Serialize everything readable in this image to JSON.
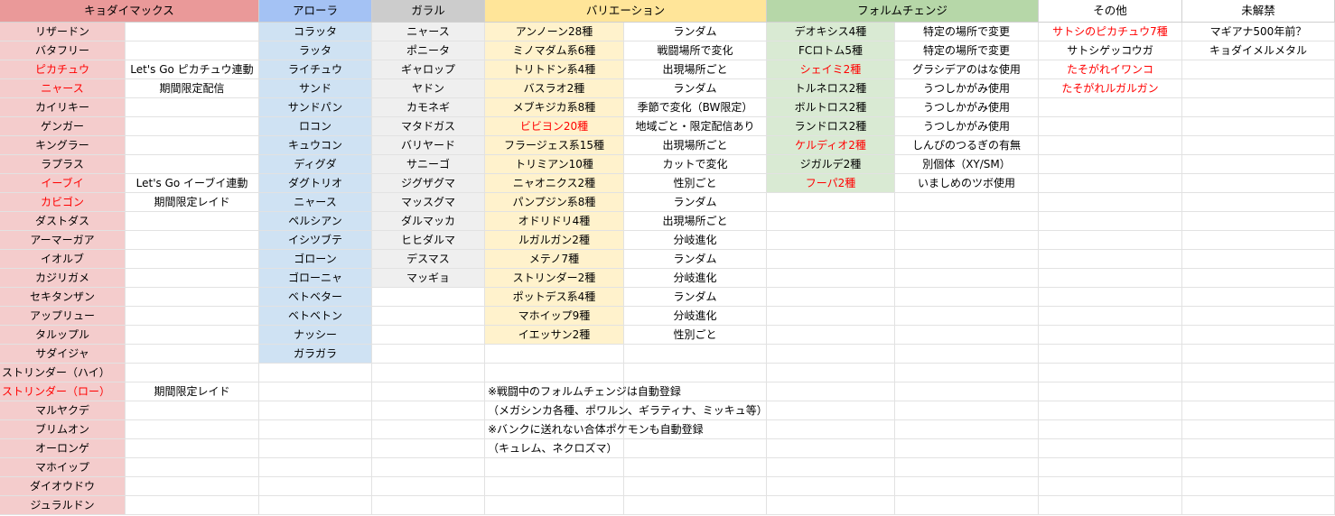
{
  "colors": {
    "header_kyodai": "#ea9999",
    "header_alola": "#a4c2f4",
    "header_galar": "#cccccc",
    "header_variation": "#ffe599",
    "header_form": "#b6d7a8",
    "header_plain": "#ffffff",
    "fill_kyodai": "#f4cccc",
    "fill_alola": "#cfe2f3",
    "fill_galar": "#efefef",
    "fill_variation": "#fff2cc",
    "fill_form": "#d9ead3",
    "text_highlight": "#ff0000"
  },
  "headers": [
    "キョダイマックス",
    "アローラ",
    "ガラル",
    "バリエーション",
    "フォルムチェンジ",
    "その他",
    "未解禁"
  ],
  "kyodai": [
    {
      "name": "リザードン",
      "note": ""
    },
    {
      "name": "バタフリー",
      "note": ""
    },
    {
      "name": "ピカチュウ",
      "note": "Let's Go ピカチュウ連動",
      "red": true
    },
    {
      "name": "ニャース",
      "note": "期間限定配信",
      "red": true
    },
    {
      "name": "カイリキー",
      "note": ""
    },
    {
      "name": "ゲンガー",
      "note": ""
    },
    {
      "name": "キングラー",
      "note": ""
    },
    {
      "name": "ラプラス",
      "note": ""
    },
    {
      "name": "イーブイ",
      "note": "Let's Go イーブイ連動",
      "red": true
    },
    {
      "name": "カビゴン",
      "note": "期間限定レイド",
      "red": true
    },
    {
      "name": "ダストダス",
      "note": ""
    },
    {
      "name": "アーマーガア",
      "note": ""
    },
    {
      "name": "イオルブ",
      "note": ""
    },
    {
      "name": "カジリガメ",
      "note": ""
    },
    {
      "name": "セキタンザン",
      "note": ""
    },
    {
      "name": "アップリュー",
      "note": ""
    },
    {
      "name": "タルップル",
      "note": ""
    },
    {
      "name": "サダイジャ",
      "note": ""
    },
    {
      "name": "ストリンダー（ハイ）",
      "note": "",
      "left": true
    },
    {
      "name": "ストリンダー（ロー）",
      "note": "期間限定レイド",
      "red": true,
      "left": true
    },
    {
      "name": "マルヤクデ",
      "note": ""
    },
    {
      "name": "ブリムオン",
      "note": ""
    },
    {
      "name": "オーロンゲ",
      "note": ""
    },
    {
      "name": "マホイップ",
      "note": ""
    },
    {
      "name": "ダイオウドウ",
      "note": ""
    },
    {
      "name": "ジュラルドン",
      "note": ""
    }
  ],
  "alola": [
    "コラッタ",
    "ラッタ",
    "ライチュウ",
    "サンド",
    "サンドパン",
    "ロコン",
    "キュウコン",
    "ディグダ",
    "ダグトリオ",
    "ニャース",
    "ペルシアン",
    "イシツブテ",
    "ゴローン",
    "ゴローニャ",
    "ベトベター",
    "ベトベトン",
    "ナッシー",
    "ガラガラ"
  ],
  "galar": [
    "ニャース",
    "ポニータ",
    "ギャロップ",
    "ヤドン",
    "カモネギ",
    "マタドガス",
    "バリヤード",
    "サニーゴ",
    "ジグザグマ",
    "マッスグマ",
    "ダルマッカ",
    "ヒヒダルマ",
    "デスマス",
    "マッギョ"
  ],
  "variation": [
    {
      "name": "アンノーン28種",
      "method": "ランダム"
    },
    {
      "name": "ミノマダム系6種",
      "method": "戦闘場所で変化"
    },
    {
      "name": "トリトドン系4種",
      "method": "出現場所ごと"
    },
    {
      "name": "バスラオ2種",
      "method": "ランダム"
    },
    {
      "name": "メブキジカ系8種",
      "method": "季節で変化（BW限定）"
    },
    {
      "name": "ビビヨン20種",
      "method": "地域ごと・限定配信あり",
      "red": true
    },
    {
      "name": "フラージェス系15種",
      "method": "出現場所ごと"
    },
    {
      "name": "トリミアン10種",
      "method": "カットで変化"
    },
    {
      "name": "ニャオニクス2種",
      "method": "性別ごと"
    },
    {
      "name": "パンプジン系8種",
      "method": "ランダム"
    },
    {
      "name": "オドリドリ4種",
      "method": "出現場所ごと"
    },
    {
      "name": "ルガルガン2種",
      "method": "分岐進化"
    },
    {
      "name": "メテノ7種",
      "method": "ランダム"
    },
    {
      "name": "ストリンダー2種",
      "method": "分岐進化"
    },
    {
      "name": "ポットデス系4種",
      "method": "ランダム"
    },
    {
      "name": "マホイップ9種",
      "method": "分岐進化"
    },
    {
      "name": "イエッサン2種",
      "method": "性別ごと"
    }
  ],
  "form": [
    {
      "name": "デオキシス4種",
      "method": "特定の場所で変更"
    },
    {
      "name": "FCロトム5種",
      "method": "特定の場所で変更"
    },
    {
      "name": "シェイミ2種",
      "method": "グラシデアのはな使用",
      "red": true
    },
    {
      "name": "トルネロス2種",
      "method": "うつしかがみ使用"
    },
    {
      "name": "ボルトロス2種",
      "method": "うつしかがみ使用"
    },
    {
      "name": "ランドロス2種",
      "method": "うつしかがみ使用"
    },
    {
      "name": "ケルディオ2種",
      "method": "しんぴのつるぎの有無",
      "red": true
    },
    {
      "name": "ジガルデ2種",
      "method": "別個体（XY/SM）"
    },
    {
      "name": "フーパ2種",
      "method": "いましめのツボ使用",
      "red": true
    }
  ],
  "other": [
    {
      "name": "サトシのピカチュウ7種",
      "red": true
    },
    {
      "name": "サトシゲッコウガ"
    },
    {
      "name": "たそがれイワンコ",
      "red": true
    },
    {
      "name": "たそがれルガルガン",
      "red": true
    }
  ],
  "unreleased": [
    "マギアナ500年前？",
    "キョダイメルメタル"
  ],
  "notes": [
    "※戦闘中のフォルムチェンジは自動登録",
    "（メガシンカ各種、ポワルン、ギラティナ、ミッキュ等）",
    "※バンクに送れない合体ポケモンも自動登録",
    "（キュレム、ネクロズマ）"
  ]
}
